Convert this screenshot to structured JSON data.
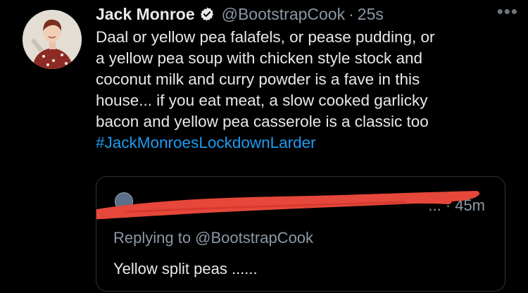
{
  "tweet": {
    "author_name": "Jack Monroe",
    "handle": "@BootstrapCook",
    "separator": "·",
    "time": "25s",
    "more_icon": "more-horizontal-icon",
    "verified_icon": "verified-badge-icon",
    "lines": [
      "Daal or yellow pea falafels, or pease pudding, or",
      "a yellow pea soup with chicken style stock and",
      "coconut milk and curry powder is a fave in this",
      "house... if you eat meat, a slow cooked garlicky",
      "bacon and yellow pea casserole is a classic too"
    ],
    "hashtag": "#JackMonroesLockdownLarder"
  },
  "quoted": {
    "visible_name_fragment": "...",
    "separator": "·",
    "time": "45m",
    "replying_to": "Replying to @BootstrapCook",
    "text": "Yellow split peas ......"
  },
  "colors": {
    "background": "#000000",
    "primary_text": "#e7e9ea",
    "secondary_text": "#8b98a5",
    "link": "#1d9bf0",
    "redaction": "#e5473a",
    "border": "#2f3336"
  }
}
